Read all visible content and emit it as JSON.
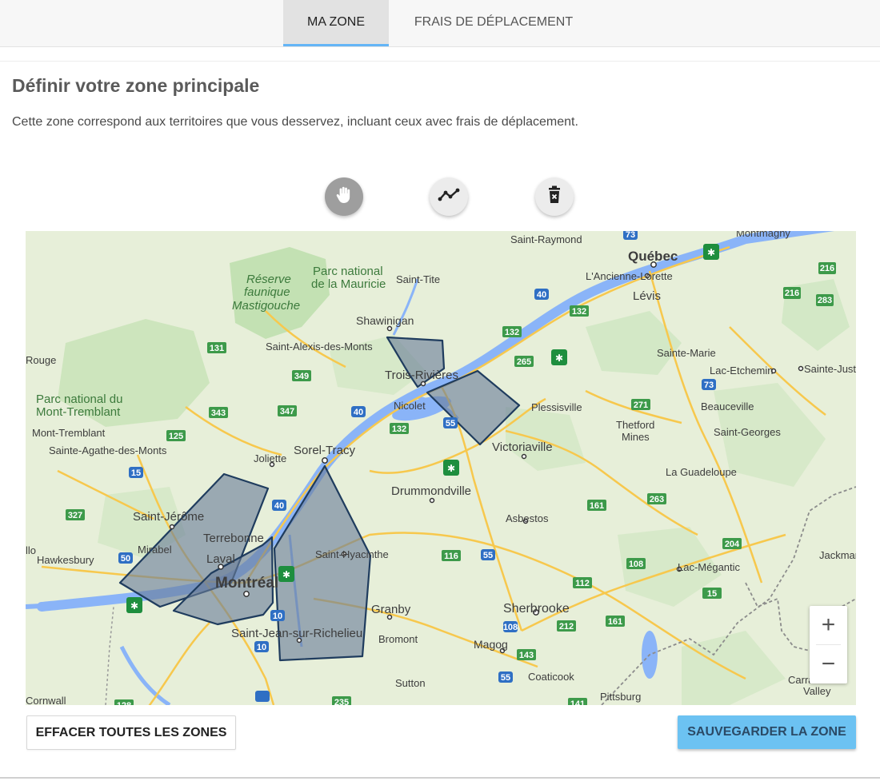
{
  "tabs": [
    {
      "label": "MA ZONE",
      "active": true
    },
    {
      "label": "FRAIS DE DÉPLACEMENT",
      "active": false
    }
  ],
  "page": {
    "title": "Définir votre zone principale",
    "description": "Cette zone correspond aux territoires que vous desservez, incluant ceux avec frais de déplacement."
  },
  "toolbar": [
    {
      "name": "hand-icon",
      "active": true
    },
    {
      "name": "polyline-icon",
      "active": false
    },
    {
      "name": "trash-icon",
      "active": false
    }
  ],
  "map": {
    "places": [
      {
        "id": "saint-raymond",
        "text": "Saint-Raymond"
      },
      {
        "id": "quebec",
        "text": "Québec"
      },
      {
        "id": "montmagny",
        "text": "Montmagny"
      },
      {
        "id": "ancienne-lorette",
        "text": "L'Ancienne-Lorette"
      },
      {
        "id": "levis",
        "text": "Lévis"
      },
      {
        "id": "parc-mauricie-1",
        "text": "Parc national"
      },
      {
        "id": "parc-mauricie-2",
        "text": "de la Mauricie"
      },
      {
        "id": "reserve-1",
        "text": "Réserve"
      },
      {
        "id": "reserve-2",
        "text": "faunique"
      },
      {
        "id": "reserve-3",
        "text": "Mastigouche"
      },
      {
        "id": "saint-tite",
        "text": "Saint-Tite"
      },
      {
        "id": "shawinigan",
        "text": "Shawinigan"
      },
      {
        "id": "saint-alexis",
        "text": "Saint-Alexis-des-Monts"
      },
      {
        "id": "trois-rivieres",
        "text": "Trois-Rivières"
      },
      {
        "id": "nicolet",
        "text": "Nicolet"
      },
      {
        "id": "plessisville",
        "text": "Plessisville"
      },
      {
        "id": "sainte-marie",
        "text": "Sainte-Marie"
      },
      {
        "id": "lac-etchemin",
        "text": "Lac-Etchemin"
      },
      {
        "id": "sainte-justine",
        "text": "Sainte-Just"
      },
      {
        "id": "beauceville",
        "text": "Beauceville"
      },
      {
        "id": "thetford-1",
        "text": "Thetford"
      },
      {
        "id": "thetford-2",
        "text": "Mines"
      },
      {
        "id": "saint-georges",
        "text": "Saint-Georges"
      },
      {
        "id": "rouge",
        "text": "Rouge"
      },
      {
        "id": "parc-tremblant-1",
        "text": "Parc national du"
      },
      {
        "id": "parc-tremblant-2",
        "text": "Mont-Tremblant"
      },
      {
        "id": "mont-tremblant",
        "text": "Mont-Tremblant"
      },
      {
        "id": "sainte-agathe",
        "text": "Sainte-Agathe-des-Monts"
      },
      {
        "id": "joliette",
        "text": "Joliette"
      },
      {
        "id": "sorel",
        "text": "Sorel-Tracy"
      },
      {
        "id": "victoriaville",
        "text": "Victoriaville"
      },
      {
        "id": "la-guadeloupe",
        "text": "La Guadeloupe"
      },
      {
        "id": "drummondville",
        "text": "Drummondville"
      },
      {
        "id": "saint-jerome",
        "text": "Saint-Jérôme"
      },
      {
        "id": "terrebonne",
        "text": "Terrebonne"
      },
      {
        "id": "mirabel",
        "text": "Mirabel"
      },
      {
        "id": "laval",
        "text": "Laval"
      },
      {
        "id": "hawkesbury",
        "text": "Hawkesbury"
      },
      {
        "id": "llo",
        "text": "llo"
      },
      {
        "id": "montreal",
        "text": "Montréal"
      },
      {
        "id": "saint-hyacinthe",
        "text": "Saint-Hyacinthe"
      },
      {
        "id": "asbestos",
        "text": "Asbestos"
      },
      {
        "id": "jackman",
        "text": "Jackman"
      },
      {
        "id": "lac-megantic",
        "text": "Lac-Mégantic"
      },
      {
        "id": "granby",
        "text": "Granby"
      },
      {
        "id": "sherbrooke",
        "text": "Sherbrooke"
      },
      {
        "id": "saint-jean",
        "text": "Saint-Jean-sur-Richelieu"
      },
      {
        "id": "bromont",
        "text": "Bromont"
      },
      {
        "id": "magog",
        "text": "Magog"
      },
      {
        "id": "coaticook",
        "text": "Coaticook"
      },
      {
        "id": "sutton",
        "text": "Sutton"
      },
      {
        "id": "pittsburg",
        "text": "Pittsburg"
      },
      {
        "id": "cornwall",
        "text": "Cornwall"
      },
      {
        "id": "carrabasset-1",
        "text": "Carrabasset"
      },
      {
        "id": "carrabasset-2",
        "text": "Valley"
      }
    ],
    "routes": [
      "73",
      "216",
      "216",
      "283",
      "40",
      "132",
      "132",
      "265",
      "73",
      "271",
      "131",
      "349",
      "347",
      "343",
      "40",
      "132",
      "55",
      "125",
      "15",
      "40",
      "327",
      "161",
      "263",
      "116",
      "55",
      "204",
      "50",
      "108",
      "112",
      "10",
      "108",
      "212",
      "161",
      "15",
      "10",
      "143",
      "55",
      "235",
      "141",
      "128"
    ],
    "zoom_in": "+",
    "zoom_out": "−"
  },
  "actions": {
    "clear_all": "EFFACER TOUTES LES ZONES",
    "save": "SAUVEGARDER LA ZONE"
  },
  "colors": {
    "accent": "#6cc2f2",
    "tab_underline": "#64b5f6",
    "zone_fill": "#6b7e99",
    "zone_stroke": "#1f3c5e"
  }
}
